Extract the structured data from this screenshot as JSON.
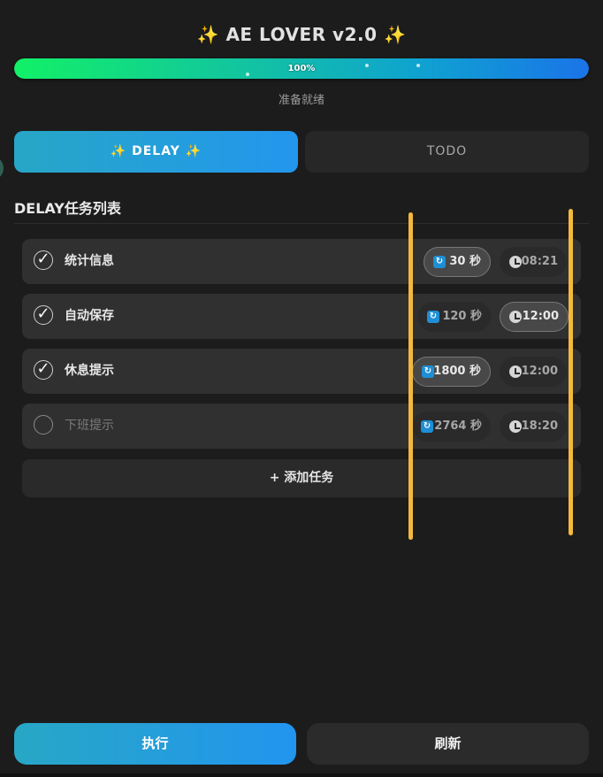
{
  "header": {
    "title_text": "AE LOVER v2.0",
    "spark_left": "✨",
    "spark_right": "✨"
  },
  "progress": {
    "value_percent": 100,
    "label": "100%",
    "status": "准备就绪"
  },
  "tabs": [
    {
      "label": "✨ DELAY ✨",
      "active": true
    },
    {
      "label": "TODO",
      "active": false
    }
  ],
  "section": {
    "title": "DELAY任务列表"
  },
  "tasks": [
    {
      "name": "统计信息",
      "checked": true,
      "check_glyph": "✓",
      "interval": "30 秒",
      "time": "08:21",
      "interval_active": true,
      "time_active": false
    },
    {
      "name": "自动保存",
      "checked": true,
      "check_glyph": "✓",
      "interval": "120 秒",
      "time": "12:00",
      "interval_active": false,
      "time_active": true
    },
    {
      "name": "休息提示",
      "checked": true,
      "check_glyph": "✓",
      "interval": "1800 秒",
      "time": "12:00",
      "interval_active": true,
      "time_active": false
    },
    {
      "name": "下班提示",
      "checked": false,
      "check_glyph": "",
      "interval": "2764 秒",
      "time": "18:20",
      "interval_active": false,
      "time_active": false
    }
  ],
  "add_task": {
    "label": "+ 添加任务"
  },
  "footer": {
    "run_label": "执行",
    "refresh_label": "刷新"
  },
  "icons": {
    "interval": "refresh-icon",
    "time": "clock-icon"
  },
  "colors": {
    "accent_gradient_start": "#27a7c6",
    "accent_gradient_end": "#2396ee",
    "progress_start": "#12f067",
    "progress_end": "#1a74e8",
    "highlight_line": "#f3b93a",
    "background": "#1c1c1c"
  }
}
